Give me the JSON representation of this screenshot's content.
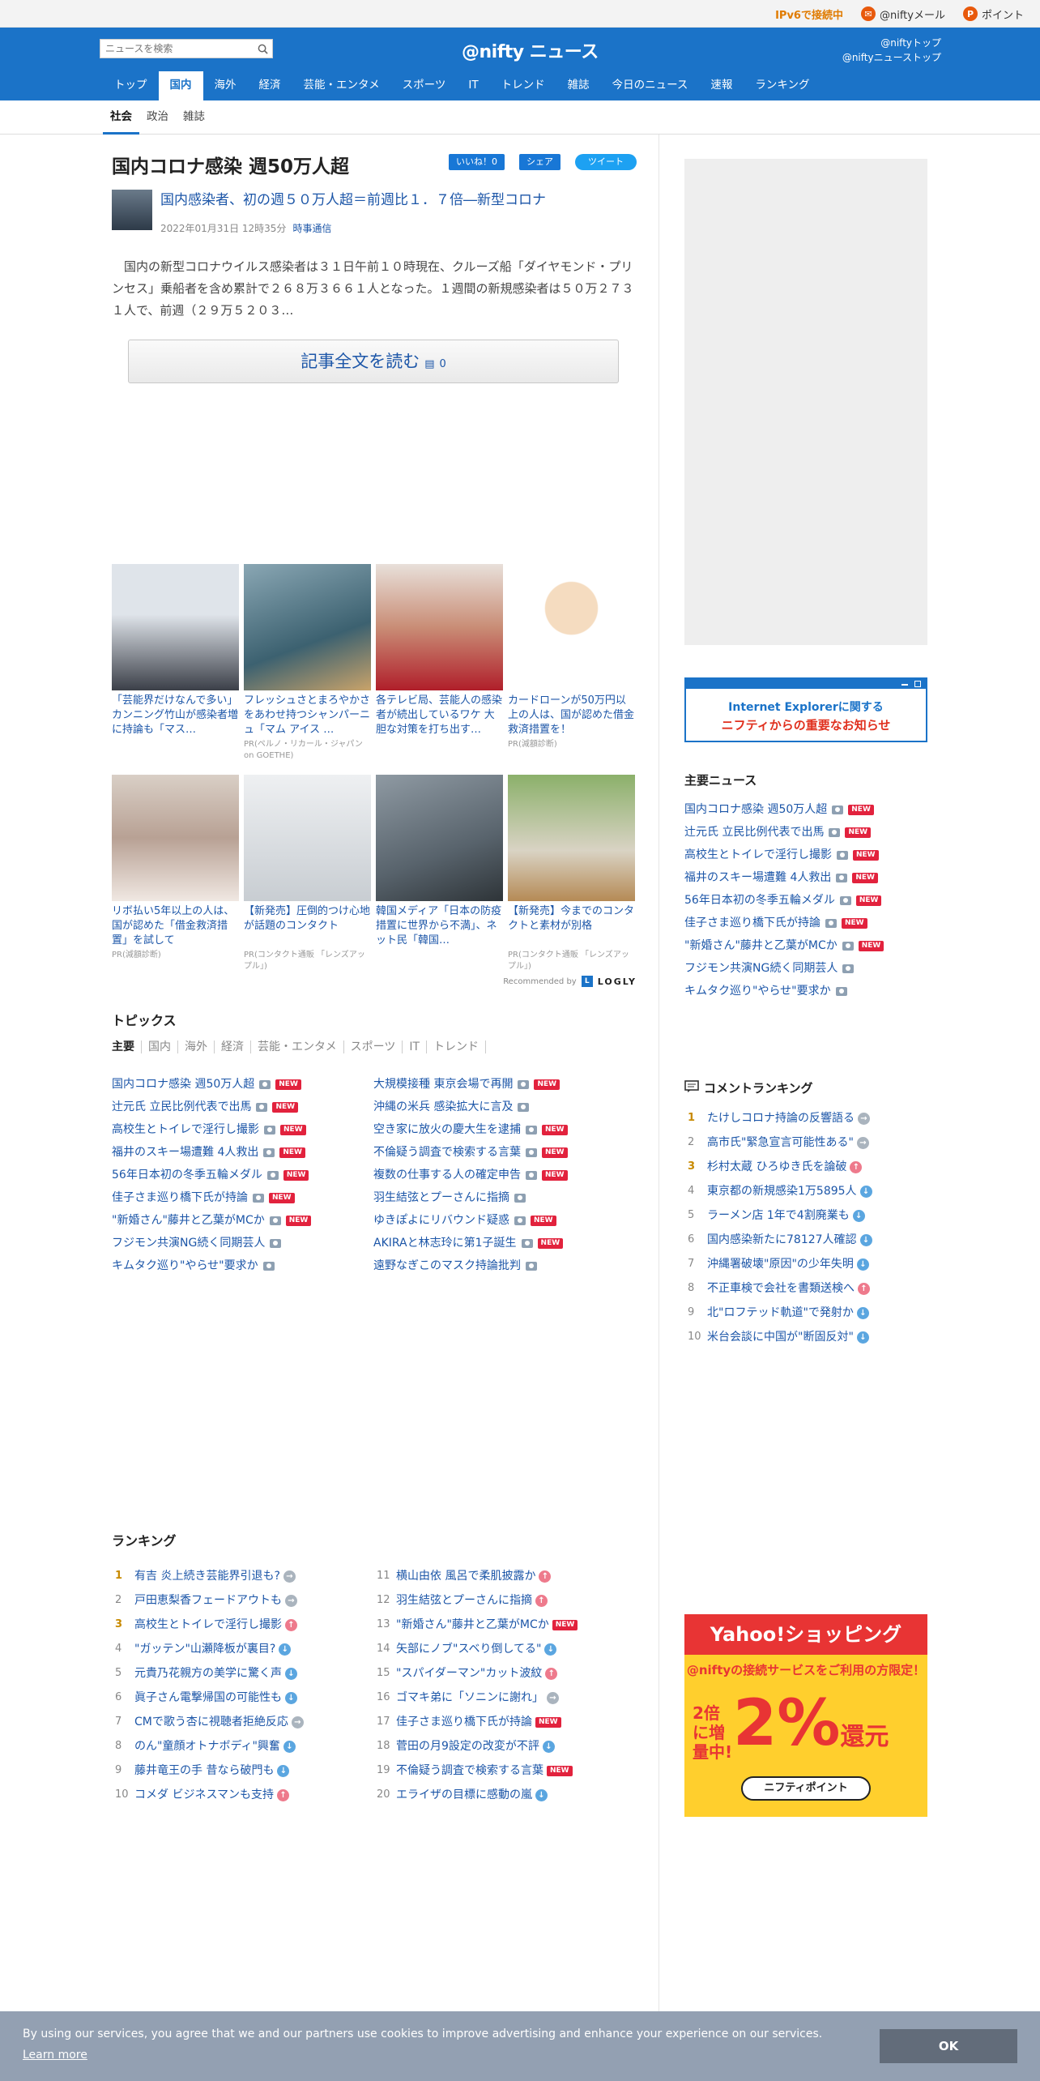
{
  "topbar": {
    "ipv6": "IPv6で接続中",
    "mail": "@niftyメール",
    "point": "ポイント"
  },
  "header": {
    "search_placeholder": "ニュースを検索",
    "logo": "@nifty ニュース",
    "top_link": "@niftyトップ",
    "news_top_link": "@niftyニューストップ"
  },
  "gnav": [
    "トップ",
    "国内",
    "海外",
    "経済",
    "芸能・エンタメ",
    "スポーツ",
    "IT",
    "トレンド",
    "雑誌",
    "今日のニュース",
    "速報",
    "ランキング"
  ],
  "subnav": [
    "社会",
    "政治",
    "雑誌"
  ],
  "article": {
    "title": "国内コロナ感染 週50万人超",
    "like": "いいね！0",
    "share": "シェア",
    "tweet": "ツイート",
    "subtitle": "国内感染者、初の週５０万人超＝前週比１．７倍―新型コロナ",
    "date": "2022年01月31日 12時35分",
    "source": "時事通信",
    "body": "国内の新型コロナウイルス感染者は３１日午前１０時現在、クルーズ船「ダイヤモンド・プリンセス」乗船者を含め累計で２６８万３６６１人となった。１週間の新規感染者は５０万２７３１人で、前週（２９万５２０３…",
    "read_more": "記事全文を読む",
    "comments": "0"
  },
  "recommend": [
    {
      "title": "「芸能界だけなんで多い」カンニング竹山が感染者増に持論も「マス…",
      "pr": ""
    },
    {
      "title": "フレッシュさとまろやかさをあわせ持つシャンパーニュ「マム アイス …",
      "pr": "PR(ペルノ・リカール・ジャパン on GOETHE)"
    },
    {
      "title": "各テレビ局、芸能人の感染者が続出しているワケ 大胆な対策を打ち出す…",
      "pr": ""
    },
    {
      "title": "カードローンが50万円以上の人は、国が認めた借金救済措置を！",
      "pr": "PR(減額診断)"
    },
    {
      "title": "リボ払い5年以上の人は、国が認めた「借金救済措置」を試して",
      "pr": "PR(減額診断)"
    },
    {
      "title": "【新発売】圧倒的つけ心地が話題のコンタクト",
      "pr": "PR(コンタクト通販 「レンズアップル」)"
    },
    {
      "title": "韓国メディア「日本の防疫措置に世界から不満」、ネット民「韓国…",
      "pr": ""
    },
    {
      "title": "【新発売】今までのコンタクトと素材が別格",
      "pr": "PR(コンタクト通販 「レンズアップル」)"
    }
  ],
  "recommended_by": "Recommended by",
  "logly": "LOGLY",
  "topics": {
    "title": "トピックス",
    "tabs": [
      "主要",
      "国内",
      "海外",
      "経済",
      "芸能・エンタメ",
      "スポーツ",
      "IT",
      "トレンド"
    ],
    "left": [
      {
        "t": "国内コロナ感染 週50万人超",
        "new": true
      },
      {
        "t": "辻元氏 立民比例代表で出馬",
        "new": true
      },
      {
        "t": "高校生とトイレで淫行し撮影",
        "new": true
      },
      {
        "t": "福井のスキー場遭難 4人救出",
        "new": true
      },
      {
        "t": "56年日本初の冬季五輪メダル",
        "new": true
      },
      {
        "t": "佳子さま巡り橋下氏が持論",
        "new": true
      },
      {
        "t": "\"新婚さん\"藤井と乙葉がMCか",
        "new": true
      },
      {
        "t": "フジモン共演NG続く同期芸人",
        "new": false
      },
      {
        "t": "キムタク巡り\"やらせ\"要求か",
        "new": false
      }
    ],
    "right": [
      {
        "t": "大規模接種 東京会場で再開",
        "new": true
      },
      {
        "t": "沖縄の米兵 感染拡大に言及",
        "new": false
      },
      {
        "t": "空き家に放火の慶大生を逮捕",
        "new": true
      },
      {
        "t": "不倫疑う調査で検索する言葉",
        "new": true
      },
      {
        "t": "複数の仕事する人の確定申告",
        "new": true
      },
      {
        "t": "羽生結弦とプーさんに指摘",
        "new": false
      },
      {
        "t": "ゆきぽよにリバウンド疑惑",
        "new": true
      },
      {
        "t": "AKIRAと林志玲に第1子誕生",
        "new": true
      },
      {
        "t": "遠野なぎこのマスク持論批判",
        "new": false
      }
    ]
  },
  "ranking": {
    "title": "ランキング",
    "left": [
      {
        "n": "1",
        "t": "有吉 炎上続き芸能界引退も?",
        "a": "r"
      },
      {
        "n": "2",
        "t": "戸田恵梨香フェードアウトも",
        "a": "r"
      },
      {
        "n": "3",
        "t": "高校生とトイレで淫行し撮影",
        "a": "up"
      },
      {
        "n": "4",
        "t": "\"ガッテン\"山瀬降板が裏目?",
        "a": "down"
      },
      {
        "n": "5",
        "t": "元貴乃花親方の美学に驚く声",
        "a": "down"
      },
      {
        "n": "6",
        "t": "眞子さん電撃帰国の可能性も",
        "a": "down"
      },
      {
        "n": "7",
        "t": "CMで歌う杏に視聴者拒絶反応",
        "a": "r"
      },
      {
        "n": "8",
        "t": "のん\"童顔オトナボディ\"興奮",
        "a": "down"
      },
      {
        "n": "9",
        "t": "藤井竜王の手 昔なら破門も",
        "a": "down"
      },
      {
        "n": "10",
        "t": "コメダ ビジネスマンも支持",
        "a": "up"
      }
    ],
    "right": [
      {
        "n": "11",
        "t": "横山由依 風呂で柔肌披露か",
        "a": "up"
      },
      {
        "n": "12",
        "t": "羽生結弦とプーさんに指摘",
        "a": "up"
      },
      {
        "n": "13",
        "t": "\"新婚さん\"藤井と乙葉がMCか",
        "a": "new"
      },
      {
        "n": "14",
        "t": "矢部にノブ\"スベり倒してる\"",
        "a": "down"
      },
      {
        "n": "15",
        "t": "\"スパイダーマン\"カット波紋",
        "a": "up"
      },
      {
        "n": "16",
        "t": "ゴマキ弟に「ソニンに謝れ」",
        "a": "r"
      },
      {
        "n": "17",
        "t": "佳子さま巡り橋下氏が持論",
        "a": "new"
      },
      {
        "n": "18",
        "t": "菅田の月9設定の改変が不評",
        "a": "down"
      },
      {
        "n": "19",
        "t": "不倫疑う調査で検索する言葉",
        "a": "new"
      },
      {
        "n": "20",
        "t": "エライザの目標に感動の嵐",
        "a": "down"
      }
    ]
  },
  "side": {
    "ie_line1": "Internet Explorerに関する",
    "ie_line2": "ニフティからの重要なお知らせ",
    "main_news_title": "主要ニュース",
    "main_news": [
      {
        "t": "国内コロナ感染 週50万人超",
        "new": true
      },
      {
        "t": "辻元氏 立民比例代表で出馬",
        "new": true
      },
      {
        "t": "高校生とトイレで淫行し撮影",
        "new": true
      },
      {
        "t": "福井のスキー場遭難 4人救出",
        "new": true
      },
      {
        "t": "56年日本初の冬季五輪メダル",
        "new": true
      },
      {
        "t": "佳子さま巡り橋下氏が持論",
        "new": true
      },
      {
        "t": "\"新婚さん\"藤井と乙葉がMCか",
        "new": true
      },
      {
        "t": "フジモン共演NG続く同期芸人",
        "new": false
      },
      {
        "t": "キムタク巡り\"やらせ\"要求か",
        "new": false
      }
    ],
    "comment_title": "コメントランキング",
    "comments": [
      {
        "n": "1",
        "t": "たけしコロナ持論の反響語る",
        "a": "r"
      },
      {
        "n": "2",
        "t": "高市氏\"緊急宣言可能性ある\"",
        "a": "r"
      },
      {
        "n": "3",
        "t": "杉村太蔵 ひろゆき氏を論破",
        "a": "up"
      },
      {
        "n": "4",
        "t": "東京都の新規感染1万5895人",
        "a": "down"
      },
      {
        "n": "5",
        "t": "ラーメン店 1年で4割廃業も",
        "a": "down"
      },
      {
        "n": "6",
        "t": "国内感染新たに78127人確認",
        "a": "down"
      },
      {
        "n": "7",
        "t": "沖縄署破壊\"原因\"の少年失明",
        "a": "down"
      },
      {
        "n": "8",
        "t": "不正車検で会社を書類送検へ",
        "a": "up"
      },
      {
        "n": "9",
        "t": "北\"ロフテッド軌道\"で発射か",
        "a": "down"
      },
      {
        "n": "10",
        "t": "米台会談に中国が\"断固反対\"",
        "a": "down"
      }
    ],
    "yahoo_title": "Yahoo!ショッピング",
    "yahoo_line": "@niftyの接続サービスをご利用の方限定！",
    "yahoo_big": "2%",
    "yahoo_small": "還元",
    "yahoo_left": "2倍に増量中!",
    "yahoo_pill": "ニフティポイント"
  },
  "cookie": {
    "msg": "By using our services, you agree that we and our partners use cookies to improve advertising and enhance your experience on our services.",
    "learn": "Learn more",
    "ok": "OK"
  }
}
